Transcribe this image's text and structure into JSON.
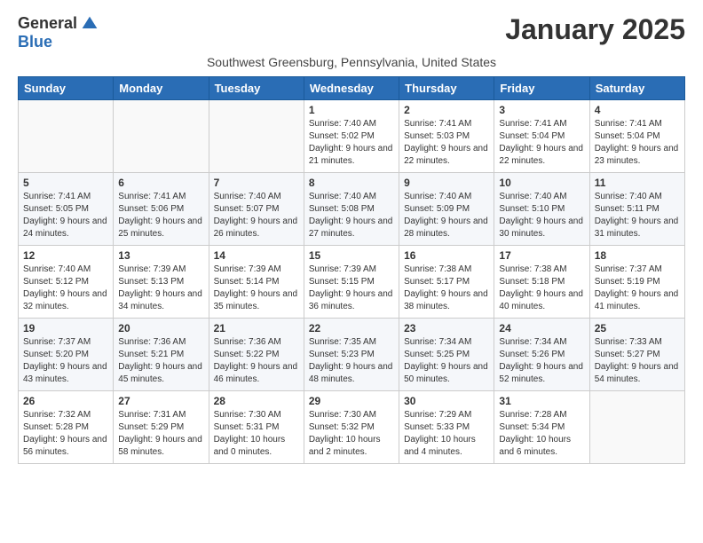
{
  "logo": {
    "general": "General",
    "blue": "Blue"
  },
  "title": "January 2025",
  "location": "Southwest Greensburg, Pennsylvania, United States",
  "weekdays": [
    "Sunday",
    "Monday",
    "Tuesday",
    "Wednesday",
    "Thursday",
    "Friday",
    "Saturday"
  ],
  "weeks": [
    [
      {
        "day": "",
        "info": ""
      },
      {
        "day": "",
        "info": ""
      },
      {
        "day": "",
        "info": ""
      },
      {
        "day": "1",
        "info": "Sunrise: 7:40 AM\nSunset: 5:02 PM\nDaylight: 9 hours and 21 minutes."
      },
      {
        "day": "2",
        "info": "Sunrise: 7:41 AM\nSunset: 5:03 PM\nDaylight: 9 hours and 22 minutes."
      },
      {
        "day": "3",
        "info": "Sunrise: 7:41 AM\nSunset: 5:04 PM\nDaylight: 9 hours and 22 minutes."
      },
      {
        "day": "4",
        "info": "Sunrise: 7:41 AM\nSunset: 5:04 PM\nDaylight: 9 hours and 23 minutes."
      }
    ],
    [
      {
        "day": "5",
        "info": "Sunrise: 7:41 AM\nSunset: 5:05 PM\nDaylight: 9 hours and 24 minutes."
      },
      {
        "day": "6",
        "info": "Sunrise: 7:41 AM\nSunset: 5:06 PM\nDaylight: 9 hours and 25 minutes."
      },
      {
        "day": "7",
        "info": "Sunrise: 7:40 AM\nSunset: 5:07 PM\nDaylight: 9 hours and 26 minutes."
      },
      {
        "day": "8",
        "info": "Sunrise: 7:40 AM\nSunset: 5:08 PM\nDaylight: 9 hours and 27 minutes."
      },
      {
        "day": "9",
        "info": "Sunrise: 7:40 AM\nSunset: 5:09 PM\nDaylight: 9 hours and 28 minutes."
      },
      {
        "day": "10",
        "info": "Sunrise: 7:40 AM\nSunset: 5:10 PM\nDaylight: 9 hours and 30 minutes."
      },
      {
        "day": "11",
        "info": "Sunrise: 7:40 AM\nSunset: 5:11 PM\nDaylight: 9 hours and 31 minutes."
      }
    ],
    [
      {
        "day": "12",
        "info": "Sunrise: 7:40 AM\nSunset: 5:12 PM\nDaylight: 9 hours and 32 minutes."
      },
      {
        "day": "13",
        "info": "Sunrise: 7:39 AM\nSunset: 5:13 PM\nDaylight: 9 hours and 34 minutes."
      },
      {
        "day": "14",
        "info": "Sunrise: 7:39 AM\nSunset: 5:14 PM\nDaylight: 9 hours and 35 minutes."
      },
      {
        "day": "15",
        "info": "Sunrise: 7:39 AM\nSunset: 5:15 PM\nDaylight: 9 hours and 36 minutes."
      },
      {
        "day": "16",
        "info": "Sunrise: 7:38 AM\nSunset: 5:17 PM\nDaylight: 9 hours and 38 minutes."
      },
      {
        "day": "17",
        "info": "Sunrise: 7:38 AM\nSunset: 5:18 PM\nDaylight: 9 hours and 40 minutes."
      },
      {
        "day": "18",
        "info": "Sunrise: 7:37 AM\nSunset: 5:19 PM\nDaylight: 9 hours and 41 minutes."
      }
    ],
    [
      {
        "day": "19",
        "info": "Sunrise: 7:37 AM\nSunset: 5:20 PM\nDaylight: 9 hours and 43 minutes."
      },
      {
        "day": "20",
        "info": "Sunrise: 7:36 AM\nSunset: 5:21 PM\nDaylight: 9 hours and 45 minutes."
      },
      {
        "day": "21",
        "info": "Sunrise: 7:36 AM\nSunset: 5:22 PM\nDaylight: 9 hours and 46 minutes."
      },
      {
        "day": "22",
        "info": "Sunrise: 7:35 AM\nSunset: 5:23 PM\nDaylight: 9 hours and 48 minutes."
      },
      {
        "day": "23",
        "info": "Sunrise: 7:34 AM\nSunset: 5:25 PM\nDaylight: 9 hours and 50 minutes."
      },
      {
        "day": "24",
        "info": "Sunrise: 7:34 AM\nSunset: 5:26 PM\nDaylight: 9 hours and 52 minutes."
      },
      {
        "day": "25",
        "info": "Sunrise: 7:33 AM\nSunset: 5:27 PM\nDaylight: 9 hours and 54 minutes."
      }
    ],
    [
      {
        "day": "26",
        "info": "Sunrise: 7:32 AM\nSunset: 5:28 PM\nDaylight: 9 hours and 56 minutes."
      },
      {
        "day": "27",
        "info": "Sunrise: 7:31 AM\nSunset: 5:29 PM\nDaylight: 9 hours and 58 minutes."
      },
      {
        "day": "28",
        "info": "Sunrise: 7:30 AM\nSunset: 5:31 PM\nDaylight: 10 hours and 0 minutes."
      },
      {
        "day": "29",
        "info": "Sunrise: 7:30 AM\nSunset: 5:32 PM\nDaylight: 10 hours and 2 minutes."
      },
      {
        "day": "30",
        "info": "Sunrise: 7:29 AM\nSunset: 5:33 PM\nDaylight: 10 hours and 4 minutes."
      },
      {
        "day": "31",
        "info": "Sunrise: 7:28 AM\nSunset: 5:34 PM\nDaylight: 10 hours and 6 minutes."
      },
      {
        "day": "",
        "info": ""
      }
    ]
  ]
}
